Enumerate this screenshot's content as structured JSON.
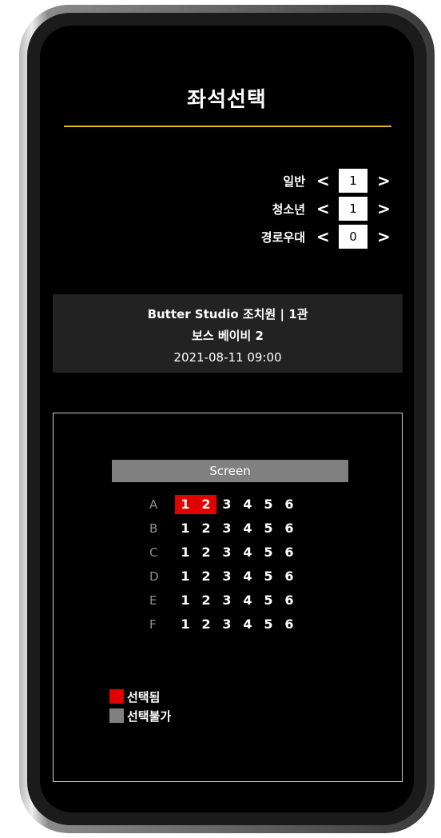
{
  "page": {
    "title": "좌석선택"
  },
  "colors": {
    "accent": "#e0b525",
    "selected": "#e00000",
    "unavailable": "#808080"
  },
  "tickets": [
    {
      "label": "일반",
      "count": "1",
      "prev": "<",
      "next": ">"
    },
    {
      "label": "청소년",
      "count": "1",
      "prev": "<",
      "next": ">"
    },
    {
      "label": "경로우대",
      "count": "0",
      "prev": "<",
      "next": ">"
    }
  ],
  "showing": {
    "theater": "Butter Studio 조치원 | 1관",
    "movie": "보스 베이비 2",
    "datetime": "2021-08-11 09:00"
  },
  "seat_map": {
    "screen_label": "Screen",
    "rows": [
      {
        "label": "A",
        "seats": [
          "1",
          "2",
          "3",
          "4",
          "5",
          "6"
        ],
        "selected": [
          0,
          1
        ]
      },
      {
        "label": "B",
        "seats": [
          "1",
          "2",
          "3",
          "4",
          "5",
          "6"
        ],
        "selected": []
      },
      {
        "label": "C",
        "seats": [
          "1",
          "2",
          "3",
          "4",
          "5",
          "6"
        ],
        "selected": []
      },
      {
        "label": "D",
        "seats": [
          "1",
          "2",
          "3",
          "4",
          "5",
          "6"
        ],
        "selected": []
      },
      {
        "label": "E",
        "seats": [
          "1",
          "2",
          "3",
          "4",
          "5",
          "6"
        ],
        "selected": []
      },
      {
        "label": "F",
        "seats": [
          "1",
          "2",
          "3",
          "4",
          "5",
          "6"
        ],
        "selected": []
      }
    ]
  },
  "legend": [
    {
      "label": "선택됨",
      "color": "#e00000"
    },
    {
      "label": "선택불가",
      "color": "#808080"
    }
  ]
}
